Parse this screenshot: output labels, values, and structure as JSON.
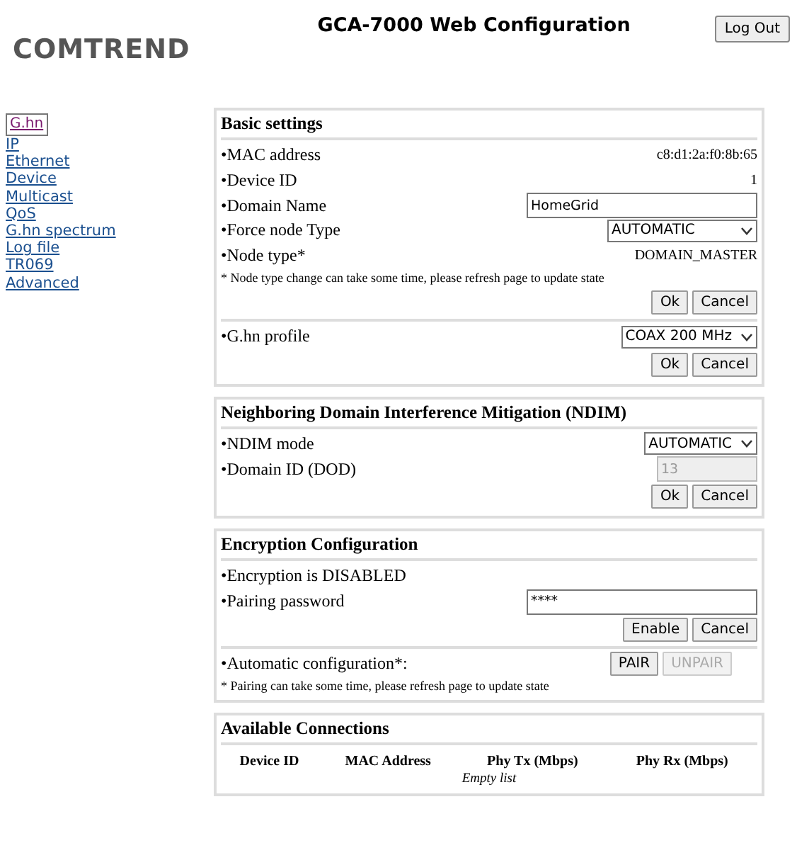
{
  "header": {
    "logo": "COMTREND",
    "title": "GCA-7000 Web Configuration",
    "logout": "Log Out"
  },
  "nav": [
    {
      "label": "G.hn",
      "selected": true
    },
    {
      "label": "IP",
      "selected": false
    },
    {
      "label": "Ethernet",
      "selected": false
    },
    {
      "label": "Device",
      "selected": false
    },
    {
      "label": "Multicast",
      "selected": false
    },
    {
      "label": "QoS",
      "selected": false
    },
    {
      "label": "G.hn spectrum",
      "selected": false
    },
    {
      "label": "Log file",
      "selected": false
    },
    {
      "label": "TR069",
      "selected": false
    },
    {
      "label": "Advanced",
      "selected": false
    }
  ],
  "sections": [
    {
      "title": "Basic settings",
      "blocks": [
        [
          {
            "kind": "value",
            "label": "•MAC address",
            "value": "c8:d1:2a:f0:8b:65"
          },
          {
            "kind": "value",
            "label": "•Device ID",
            "value": "1"
          },
          {
            "kind": "input",
            "label": "•Domain Name",
            "value": "HomeGrid",
            "disabled": false
          },
          {
            "kind": "select",
            "label": "•Force node Type",
            "value": "AUTOMATIC",
            "wide": true
          },
          {
            "kind": "value",
            "label": "•Node type*",
            "value": "DOMAIN_MASTER"
          },
          {
            "kind": "note",
            "label": "* Node type change can take some time, please refresh page to update state"
          },
          {
            "kind": "buttons",
            "buttons": [
              {
                "label": "Ok",
                "disabled": false
              },
              {
                "label": "Cancel",
                "disabled": false
              }
            ]
          }
        ],
        [
          {
            "kind": "select",
            "label": "•G.hn profile",
            "value": "COAX 200 MHz",
            "wide": false
          },
          {
            "kind": "buttons",
            "buttons": [
              {
                "label": "Ok",
                "disabled": false
              },
              {
                "label": "Cancel",
                "disabled": false
              }
            ]
          }
        ]
      ]
    },
    {
      "title": "Neighboring Domain Interference Mitigation (NDIM)",
      "blocks": [
        [
          {
            "kind": "select",
            "label": "•NDIM mode",
            "value": "AUTOMATIC",
            "wide": false
          },
          {
            "kind": "input",
            "label": "•Domain ID (DOD)",
            "value": "13",
            "disabled": true,
            "short": true
          },
          {
            "kind": "buttons",
            "buttons": [
              {
                "label": "Ok",
                "disabled": false
              },
              {
                "label": "Cancel",
                "disabled": false
              }
            ]
          }
        ]
      ]
    },
    {
      "title": "Encryption Configuration",
      "blocks": [
        [
          {
            "kind": "text",
            "label": "•Encryption is DISABLED"
          },
          {
            "kind": "input",
            "label": "•Pairing password",
            "value": "****",
            "disabled": false
          },
          {
            "kind": "buttons",
            "buttons": [
              {
                "label": "Enable",
                "disabled": false
              },
              {
                "label": "Cancel",
                "disabled": false
              }
            ]
          }
        ],
        [
          {
            "kind": "inline-buttons",
            "label": "•Automatic configuration*:",
            "buttons": [
              {
                "label": "PAIR",
                "disabled": false
              },
              {
                "label": "UNPAIR",
                "disabled": true
              }
            ]
          },
          {
            "kind": "note",
            "label": "* Pairing can take some time, please refresh page to update state"
          }
        ]
      ]
    },
    {
      "title": "Available Connections",
      "table": {
        "columns": [
          "Device ID",
          "MAC Address",
          "Phy Tx (Mbps)",
          "Phy Rx (Mbps)"
        ],
        "empty": "Empty list"
      }
    }
  ]
}
